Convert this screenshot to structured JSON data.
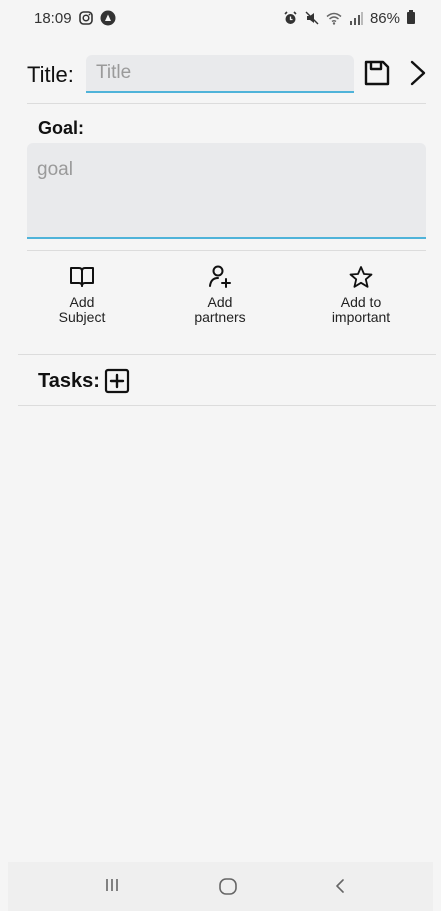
{
  "status_bar": {
    "time": "18:09",
    "battery": "86%",
    "icons_left": [
      "instagram-icon",
      "app-notification-icon"
    ],
    "icons_right": [
      "alarm-icon",
      "mute-icon",
      "wifi-icon",
      "signal-icon",
      "battery-icon"
    ]
  },
  "header": {
    "title_label": "Title:",
    "title_placeholder": "Title",
    "title_value": "",
    "save_icon": "save-icon",
    "next_icon": "chevron-right-icon"
  },
  "goal": {
    "label": "Goal:",
    "placeholder": "goal",
    "value": ""
  },
  "actions": [
    {
      "label": "Add\nSubject",
      "icon": "book-icon"
    },
    {
      "label": "Add\npartners",
      "icon": "add-person-icon"
    },
    {
      "label": "Add to\nimportant",
      "icon": "star-icon"
    }
  ],
  "tasks": {
    "label": "Tasks:",
    "add_icon": "plus-box-icon",
    "items": []
  },
  "nav_bar": {
    "buttons": [
      "recents-icon",
      "home-icon",
      "back-icon"
    ]
  },
  "colors": {
    "accent": "#4fb3d9",
    "background": "#f5f5f5",
    "input_fill": "#e9eaec"
  }
}
